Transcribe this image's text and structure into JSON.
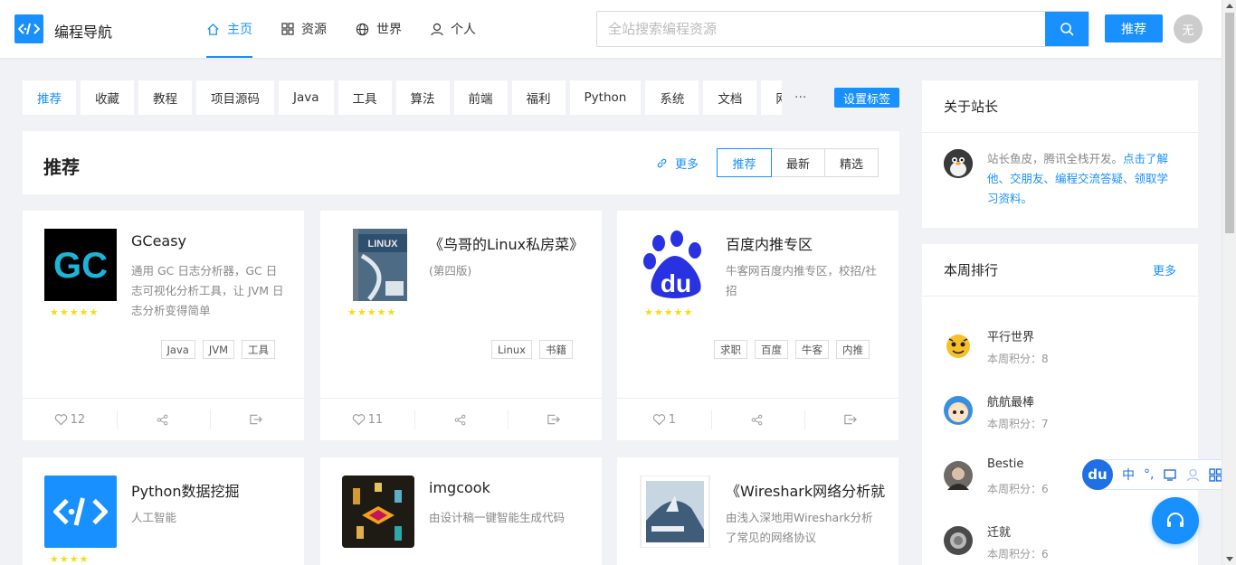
{
  "header": {
    "brand": "编程导航",
    "nav": [
      {
        "label": "主页",
        "icon": "home-icon",
        "active": true
      },
      {
        "label": "资源",
        "icon": "grid-icon"
      },
      {
        "label": "世界",
        "icon": "globe-icon"
      },
      {
        "label": "个人",
        "icon": "user-icon"
      }
    ],
    "search_placeholder": "全站搜索编程资源",
    "recommend_button": "推荐",
    "avatar_text": "无"
  },
  "tags": [
    "推荐",
    "收藏",
    "教程",
    "项目源码",
    "Java",
    "工具",
    "算法",
    "前端",
    "福利",
    "Python",
    "系统",
    "文档",
    "网"
  ],
  "tags_more": "···",
  "set_tags_label": "设置标签",
  "section": {
    "title": "推荐",
    "more": "更多",
    "segments": [
      "推荐",
      "最新",
      "精选"
    ]
  },
  "cards": [
    {
      "name": "GCeasy",
      "desc": "通用 GC 日志分析器，GC 日志可视化分析工具，让 JVM 日志分析变得简单",
      "rating": 5,
      "stars": "★★★★★",
      "tags": [
        "Java",
        "JVM",
        "工具"
      ],
      "likes": "12"
    },
    {
      "name": "《鸟哥的Linux私房菜》",
      "desc": "(第四版)",
      "rating": 5,
      "stars": "★★★★★",
      "tags": [
        "Linux",
        "书籍"
      ],
      "likes": "11"
    },
    {
      "name": "百度内推专区",
      "desc": "牛客网百度内推专区，校招/社招",
      "rating": 4.5,
      "stars": "★★★★★",
      "tags": [
        "求职",
        "百度",
        "牛客",
        "内推"
      ],
      "likes": "1"
    },
    {
      "name": "Python数据挖掘",
      "desc": "人工智能",
      "rating": 4,
      "stars": "★★★★"
    },
    {
      "name": "imgcook",
      "desc": "由设计稿一键智能生成代码"
    },
    {
      "name": "《Wireshark网络分析就是这么简单》",
      "desc": "由浅入深地用Wireshark分析了常见的网络协议"
    }
  ],
  "about": {
    "title": "关于站长",
    "text": "站长鱼皮，腾讯全栈开发。",
    "link": "点击了解他、交朋友、编程交流答疑、领取学习资料。"
  },
  "ranking": {
    "title": "本周排行",
    "more": "更多",
    "items": [
      {
        "name": "平行世界",
        "score": "本周积分：8"
      },
      {
        "name": "航航最棒",
        "score": "本周积分：7"
      },
      {
        "name": "Bestie",
        "score": "本周积分：6"
      },
      {
        "name": "迁就",
        "score": "本周积分：6"
      }
    ]
  },
  "ime": {
    "logo": "du",
    "lang": "中",
    "punct": "°,"
  },
  "colors": {
    "accent": "#1890ff",
    "star": "#fadb14"
  }
}
